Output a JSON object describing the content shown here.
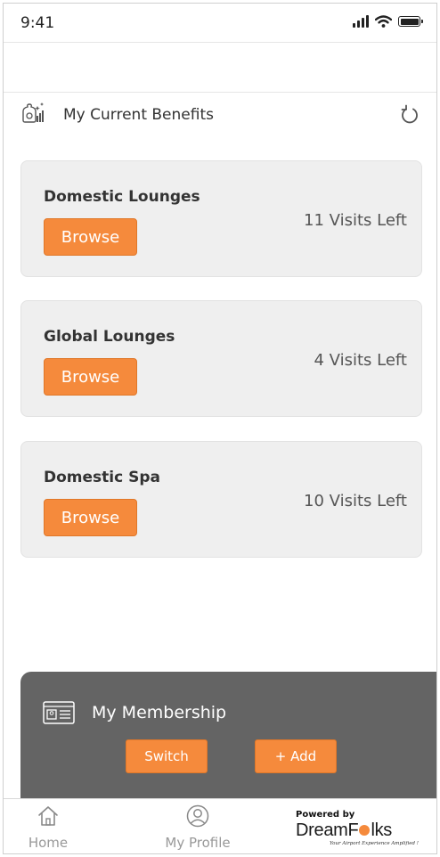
{
  "status_bar": {
    "time": "9:41"
  },
  "header": {
    "title": "My Current Benefits"
  },
  "benefits": [
    {
      "title": "Domestic Lounges",
      "button_label": "Browse",
      "visits": "11 Visits Left"
    },
    {
      "title": "Global Lounges",
      "button_label": "Browse",
      "visits": "4 Visits Left"
    },
    {
      "title": "Domestic Spa",
      "button_label": "Browse",
      "visits": "10 Visits Left"
    }
  ],
  "membership": {
    "title": "My Membership",
    "switch_label": "Switch",
    "add_label": "+ Add"
  },
  "nav": {
    "home_label": "Home",
    "profile_label": "My Profile"
  },
  "brand": {
    "powered_by": "Powered by",
    "name_part1": "DreamF",
    "name_part2": "lks",
    "tagline": "Your Airport Experience Amplified !"
  },
  "colors": {
    "accent": "#f58a3c",
    "panel": "#646464",
    "card": "#efefef"
  },
  "icons": {
    "benefits": "benefits-icon",
    "refresh": "refresh-icon",
    "membership": "membership-card-icon",
    "home": "home-icon",
    "profile": "profile-icon"
  }
}
